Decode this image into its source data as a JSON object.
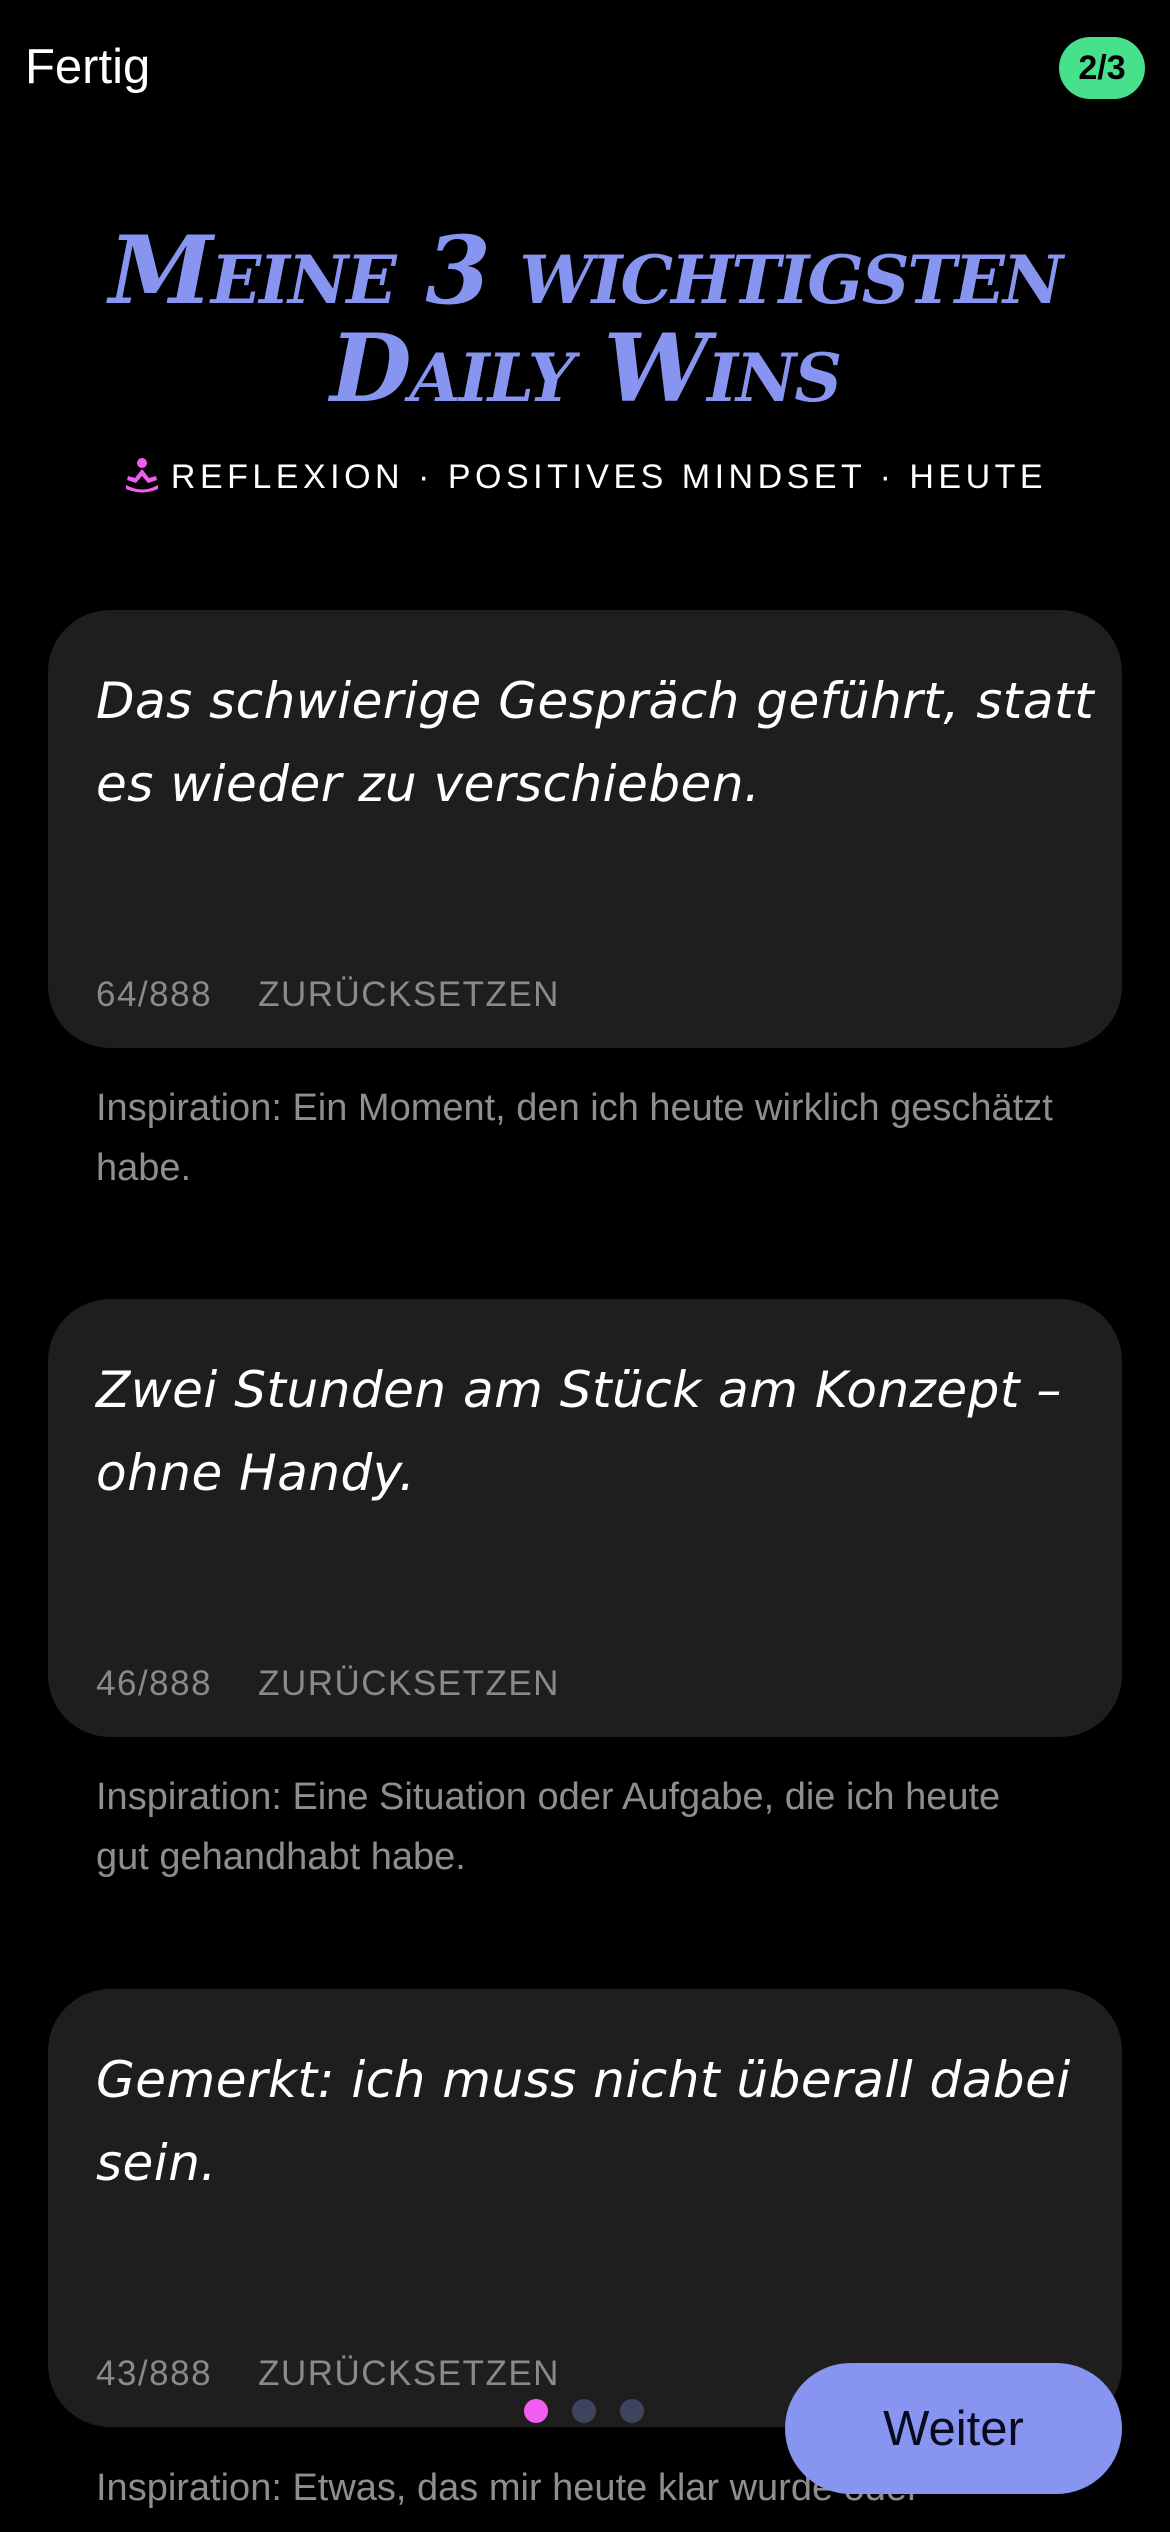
{
  "header": {
    "done_label": "Fertig",
    "progress": "2/3"
  },
  "title": {
    "line1": "Meine 3 wichtigsten",
    "line2": "Daily Wins"
  },
  "subtitle": {
    "icon": "meditation-icon",
    "text": "REFLEXION · POSITIVES MINDSET · HEUTE"
  },
  "entries": [
    {
      "text": "Das schwierige Gespräch geführt, statt es wieder zu verschieben.",
      "count": "64/888",
      "reset_label": "ZURÜCKSETZEN",
      "inspiration": "Inspiration: Ein Moment, den ich heute wirklich geschätzt habe."
    },
    {
      "text": "Zwei Stunden am Stück am Konzept – ohne Handy.",
      "count": "46/888",
      "reset_label": "ZURÜCKSETZEN",
      "inspiration": "Inspiration: Eine Situation oder Aufgabe, die ich heute gut gehandhabt habe."
    },
    {
      "text": "Gemerkt: ich muss nicht überall dabei sein.",
      "count": "43/888",
      "reset_label": "ZURÜCKSETZEN",
      "inspiration": "Inspiration: Etwas, das mir heute klar wurde oder"
    }
  ],
  "pagination": {
    "pages": 3,
    "current": 1
  },
  "footer": {
    "next_label": "Weiter"
  },
  "colors": {
    "background": "#000000",
    "card": "#1e1e1e",
    "accent": "#8895f0",
    "badge": "#47e08d",
    "active_dot": "#f25df0",
    "inactive_dot": "#3e4460",
    "muted_text": "#8e8e8e"
  }
}
